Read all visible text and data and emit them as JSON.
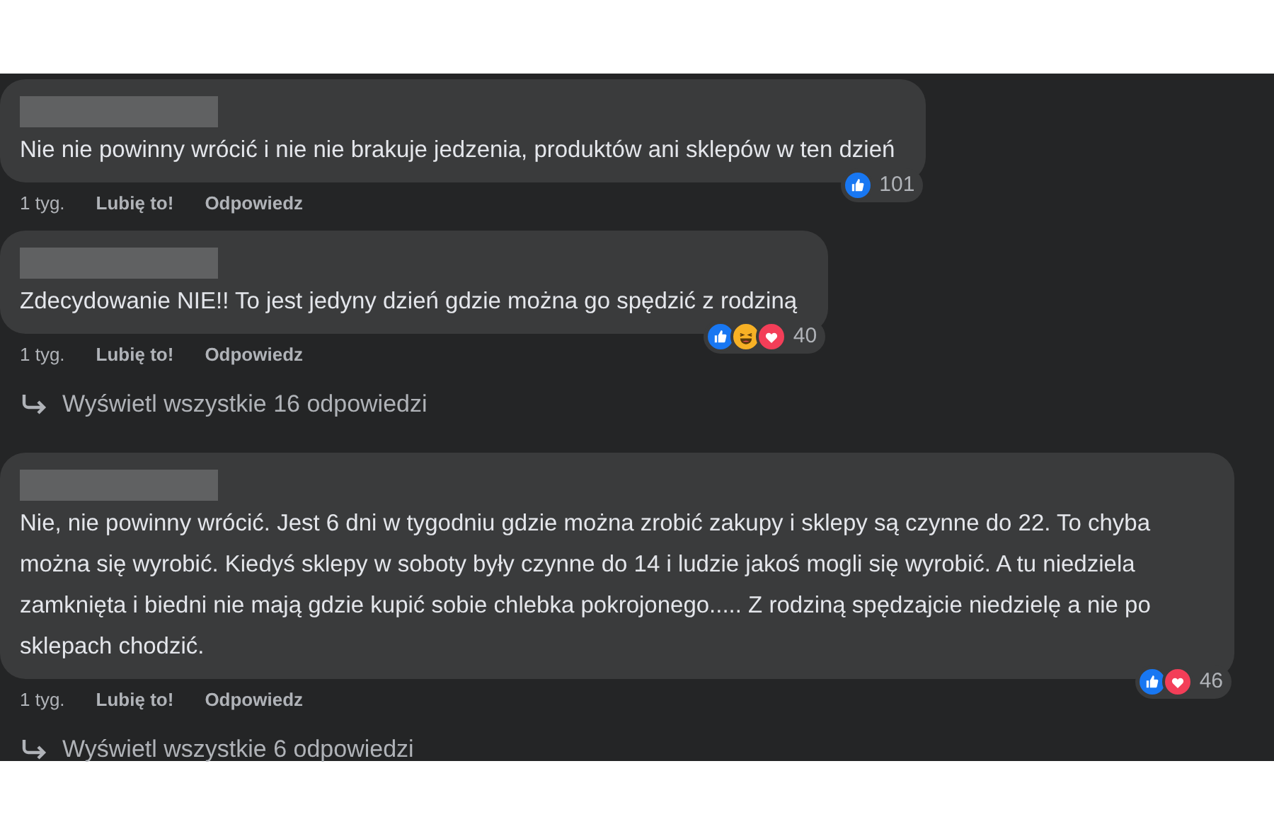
{
  "comments": [
    {
      "text": "Nie nie powinny wrócić i nie nie brakuje jedzenia, produktów ani sklepów w ten dzień",
      "reactions": [
        {
          "kind": "like"
        }
      ],
      "reaction_count": "101",
      "time": "1 tyg.",
      "like": "Lubię to!",
      "reply": "Odpowiedz"
    },
    {
      "text": "Zdecydowanie NIE!! To jest jedyny dzień gdzie można go spędzić z rodziną",
      "reactions": [
        {
          "kind": "like"
        },
        {
          "kind": "haha"
        },
        {
          "kind": "love"
        }
      ],
      "reaction_count": "40",
      "time": "1 tyg.",
      "like": "Lubię to!",
      "reply": "Odpowiedz",
      "view_replies": "Wyświetl wszystkie 16 odpowiedzi"
    },
    {
      "text": "Nie, nie powinny wrócić. Jest 6 dni w tygodniu gdzie można zrobić zakupy i sklepy są czynne do 22. To chyba można się wyrobić. Kiedyś sklepy w soboty były czynne do 14 i ludzie jakoś mogli się wyrobić. A tu niedziela zamknięta i biedni nie mają gdzie kupić sobie chlebka pokrojonego..... Z rodziną spędzajcie niedzielę a nie po sklepach chodzić.",
      "reactions": [
        {
          "kind": "like"
        },
        {
          "kind": "love"
        }
      ],
      "reaction_count": "46",
      "time": "1 tyg.",
      "like": "Lubię to!",
      "reply": "Odpowiedz",
      "view_replies": "Wyświetl wszystkie 6 odpowiedzi"
    }
  ]
}
